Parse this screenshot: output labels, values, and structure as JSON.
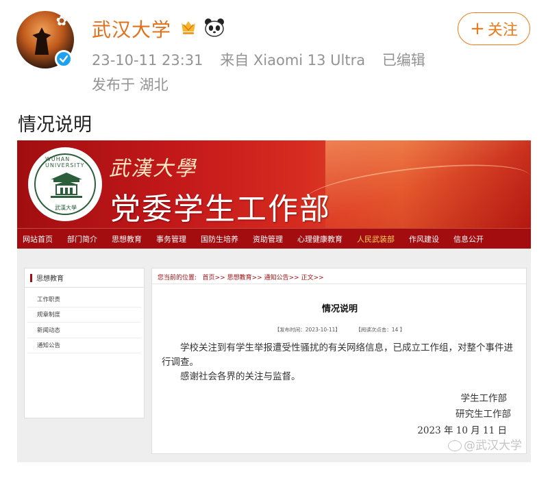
{
  "post": {
    "account_name": "武汉大学",
    "timestamp": "23-10-11 23:31",
    "source": "来自 Xiaomi 13 Ultra",
    "edited": "已编辑",
    "location": "发布于 湖北",
    "follow_label": "关注",
    "text": "情况说明"
  },
  "icons": {
    "vip_badge": "vip-badge-icon",
    "panda_badge": "panda-badge-icon",
    "verify": "verified-check-icon"
  },
  "colors": {
    "brand_orange": "#f07a1a",
    "site_red": "#a30d10",
    "nav_active": "#ffd35a"
  },
  "site": {
    "calligraphy": "武漢大學",
    "department": "党委学生工作部",
    "logo_ring_text": "WUHAN UNIVERSITY",
    "logo_base_text": "武漢大學",
    "nav": [
      "网站首页",
      "部门简介",
      "思想教育",
      "事务管理",
      "国防生培养",
      "资助管理",
      "心理健康教育",
      "人民武装部",
      "作风建设",
      "信息公开"
    ],
    "sidebar": {
      "title": "思想教育",
      "items": [
        "工作职责",
        "规章制度",
        "新闻动态",
        "通知公告"
      ]
    },
    "breadcrumb": {
      "prefix": "您当前的位置:",
      "path": [
        "首页",
        "思想教育",
        "通知公告",
        "正文"
      ],
      "separator": ">>"
    },
    "article": {
      "title": "情况说明",
      "publish_time": "【发布时间：2023-10-11】",
      "views": "【阅读次点击：14 】",
      "paragraph1": "学校关注到有学生举报遭受性骚扰的有关网络信息，已成立工作组，对整个事件进行调查。",
      "paragraph2": "感谢社会各界的关注与监督。",
      "signature1": "学生工作部",
      "signature2": "研究生工作部",
      "date": "2023 年 10 月 11 日"
    }
  },
  "watermark": "@武汉大学"
}
